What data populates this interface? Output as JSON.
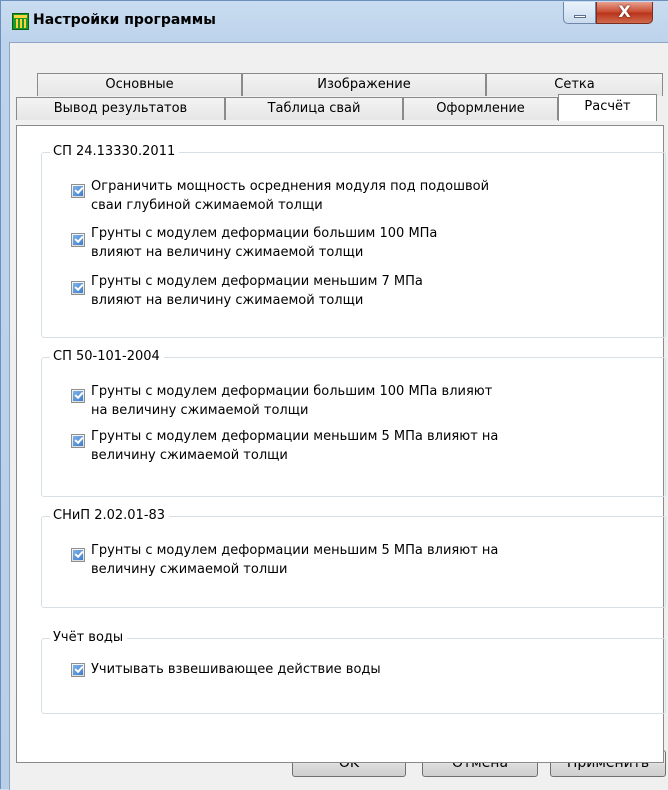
{
  "window": {
    "title": "Настройки программы",
    "minimize_glyph": "",
    "close_glyph": "X"
  },
  "tabs": {
    "row1": [
      "Основные",
      "Изображение",
      "Сетка"
    ],
    "row2": [
      "Вывод результатов",
      "Таблица свай",
      "Оформление",
      "Расчёт"
    ],
    "active": "Расчёт"
  },
  "groups": [
    {
      "label": "СП 24.13330.2011",
      "options": [
        {
          "line1": "Ограничить мощность осреднения модуля под подошвой",
          "line2": "сваи глубиной сжимаемой толщи",
          "checked": true
        },
        {
          "line1": "Грунты с модулем деформации большим 100 МПа",
          "line2": "влияют на величину сжимаемой толщи",
          "checked": true
        },
        {
          "line1": "Грунты с модулем деформации меньшим 7 МПа",
          "line2": "влияют на величину сжимаемой толщи",
          "checked": true
        }
      ]
    },
    {
      "label": "СП 50-101-2004",
      "options": [
        {
          "line1": "Грунты с модулем деформации большим 100 МПа влияют",
          "line2": "на величину сжимаемой толщи",
          "checked": true
        },
        {
          "line1": "Грунты с модулем деформации меньшим 5 МПа влияют на",
          "line2": "величину сжимаемой толщи",
          "checked": true
        }
      ]
    },
    {
      "label": "СНиП 2.02.01-83",
      "options": [
        {
          "line1": "Грунты с модулем деформации меньшим 5 МПа влияют на",
          "line2": "величину сжимаемой толши",
          "checked": true
        }
      ]
    },
    {
      "label": "Учёт воды",
      "options": [
        {
          "line1": "Учитывать взвешивающее действие воды",
          "line2": "",
          "checked": true
        }
      ]
    }
  ],
  "buttons": {
    "ok": "OK",
    "cancel": "Отмена",
    "apply": "Применить"
  },
  "colors": {
    "title_bar": "#bdd3ec",
    "close_button": "#c8472c",
    "checkbox_fill": "#3d7fcc"
  }
}
